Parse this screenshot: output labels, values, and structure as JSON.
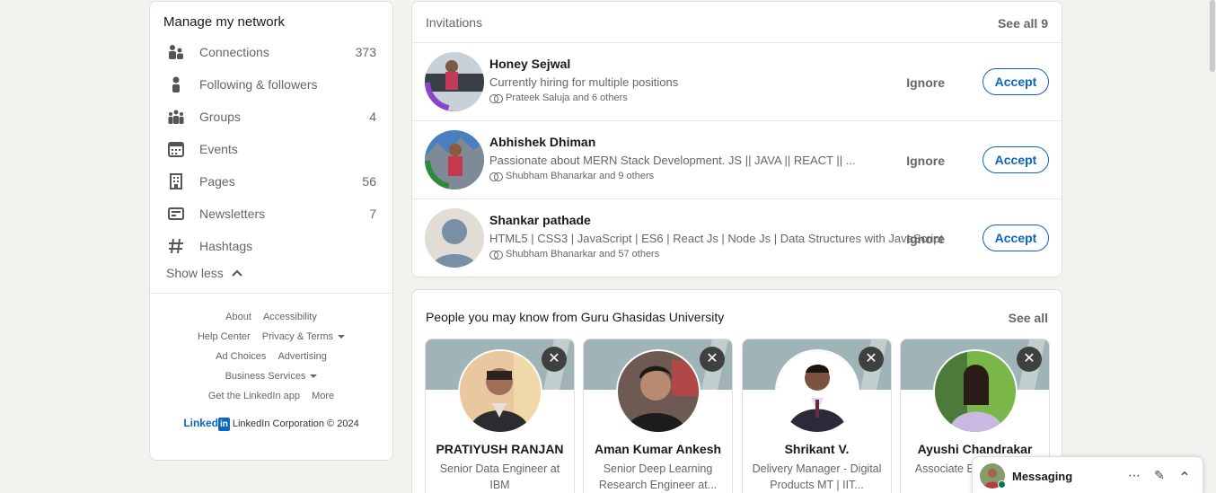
{
  "sidebar": {
    "title": "Manage my network",
    "items": [
      {
        "label": "Connections",
        "count": "373",
        "icon": "people-icon"
      },
      {
        "label": "Following & followers",
        "count": "",
        "icon": "person-icon"
      },
      {
        "label": "Groups",
        "count": "4",
        "icon": "group-icon"
      },
      {
        "label": "Events",
        "count": "",
        "icon": "calendar-icon"
      },
      {
        "label": "Pages",
        "count": "56",
        "icon": "building-icon"
      },
      {
        "label": "Newsletters",
        "count": "7",
        "icon": "newspaper-icon"
      },
      {
        "label": "Hashtags",
        "count": "",
        "icon": "hashtag-icon"
      }
    ],
    "show_less": "Show less",
    "footer": {
      "about": "About",
      "accessibility": "Accessibility",
      "help_center": "Help Center",
      "privacy_terms": "Privacy & Terms",
      "ad_choices": "Ad Choices",
      "advertising": "Advertising",
      "business_services": "Business Services",
      "get_app": "Get the LinkedIn app",
      "more": "More",
      "brand_logo": "Linked",
      "brand_logo_in": "in",
      "copyright": "LinkedIn Corporation © 2024"
    }
  },
  "invitations": {
    "title": "Invitations",
    "see_all": "See all 9",
    "ignore_label": "Ignore",
    "accept_label": "Accept",
    "items": [
      {
        "name": "Honey Sejwal",
        "headline": "Currently hiring for multiple positions",
        "mutual": "Prateek Saluja and 6 others"
      },
      {
        "name": "Abhishek Dhiman",
        "headline": "Passionate about MERN Stack Development. JS || JAVA || REACT || ...",
        "mutual": "Shubham Bhanarkar and 9 others"
      },
      {
        "name": "Shankar pathade",
        "headline": "HTML5 | CSS3 | JavaScript | ES6 | React Js | Node Js | Data Structures with JavaScript",
        "mutual": "Shubham Bhanarkar and 57 others"
      }
    ]
  },
  "pymk": {
    "title": "People you may know from Guru Ghasidas University",
    "see_all": "See all",
    "dismiss_glyph": "✕",
    "people": [
      {
        "name": "PRATIYUSH RANJAN",
        "headline": "Senior Data Engineer at IBM"
      },
      {
        "name": "Aman Kumar Ankesh",
        "headline": "Senior Deep Learning Research Engineer at..."
      },
      {
        "name": "Shrikant V.",
        "headline": "Delivery Manager - Digital Products MT | IIT..."
      },
      {
        "name": "Ayushi Chandrakar",
        "headline": "Associate Engineer at E"
      }
    ]
  },
  "messaging": {
    "label": "Messaging",
    "more_glyph": "⋯",
    "compose_glyph": "✎",
    "collapse_glyph": "⌃"
  },
  "colors": {
    "accent": "#0a66c2",
    "background": "#f4f2ee",
    "online": "#01754f"
  }
}
